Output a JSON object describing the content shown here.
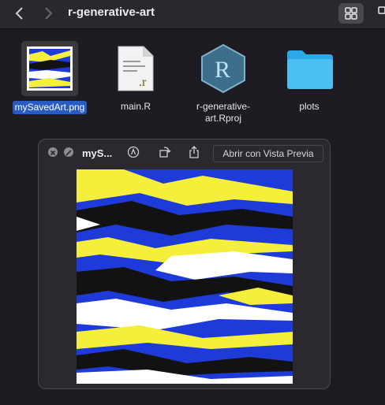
{
  "window": {
    "title": "r-generative-art"
  },
  "toolbar": {
    "back_icon": "chevron-left-icon",
    "forward_icon": "chevron-right-icon",
    "view_icon": "grid-view-icon"
  },
  "files": [
    {
      "name": "mySavedArt.png",
      "icon": "image-thumbnail",
      "selected": true
    },
    {
      "name": "main.R",
      "icon": "r-script-document-icon"
    },
    {
      "name": "r-generative-\nart.Rproj",
      "icon": "r-project-icon"
    },
    {
      "name": "plots",
      "icon": "folder-icon"
    }
  ],
  "quicklook": {
    "title": "myS...",
    "open_with_label": "Abrir con Vista Previa",
    "icons": [
      "close-icon",
      "fullscreen-icon",
      "markup-icon",
      "rotate-icon",
      "share-icon"
    ]
  },
  "colors": {
    "blue": "#1e3ad8",
    "yellow": "#f4ef3b",
    "black": "#121212",
    "white": "#ffffff",
    "selection": "#2a5bc0",
    "folder": "#2aa8e8"
  }
}
